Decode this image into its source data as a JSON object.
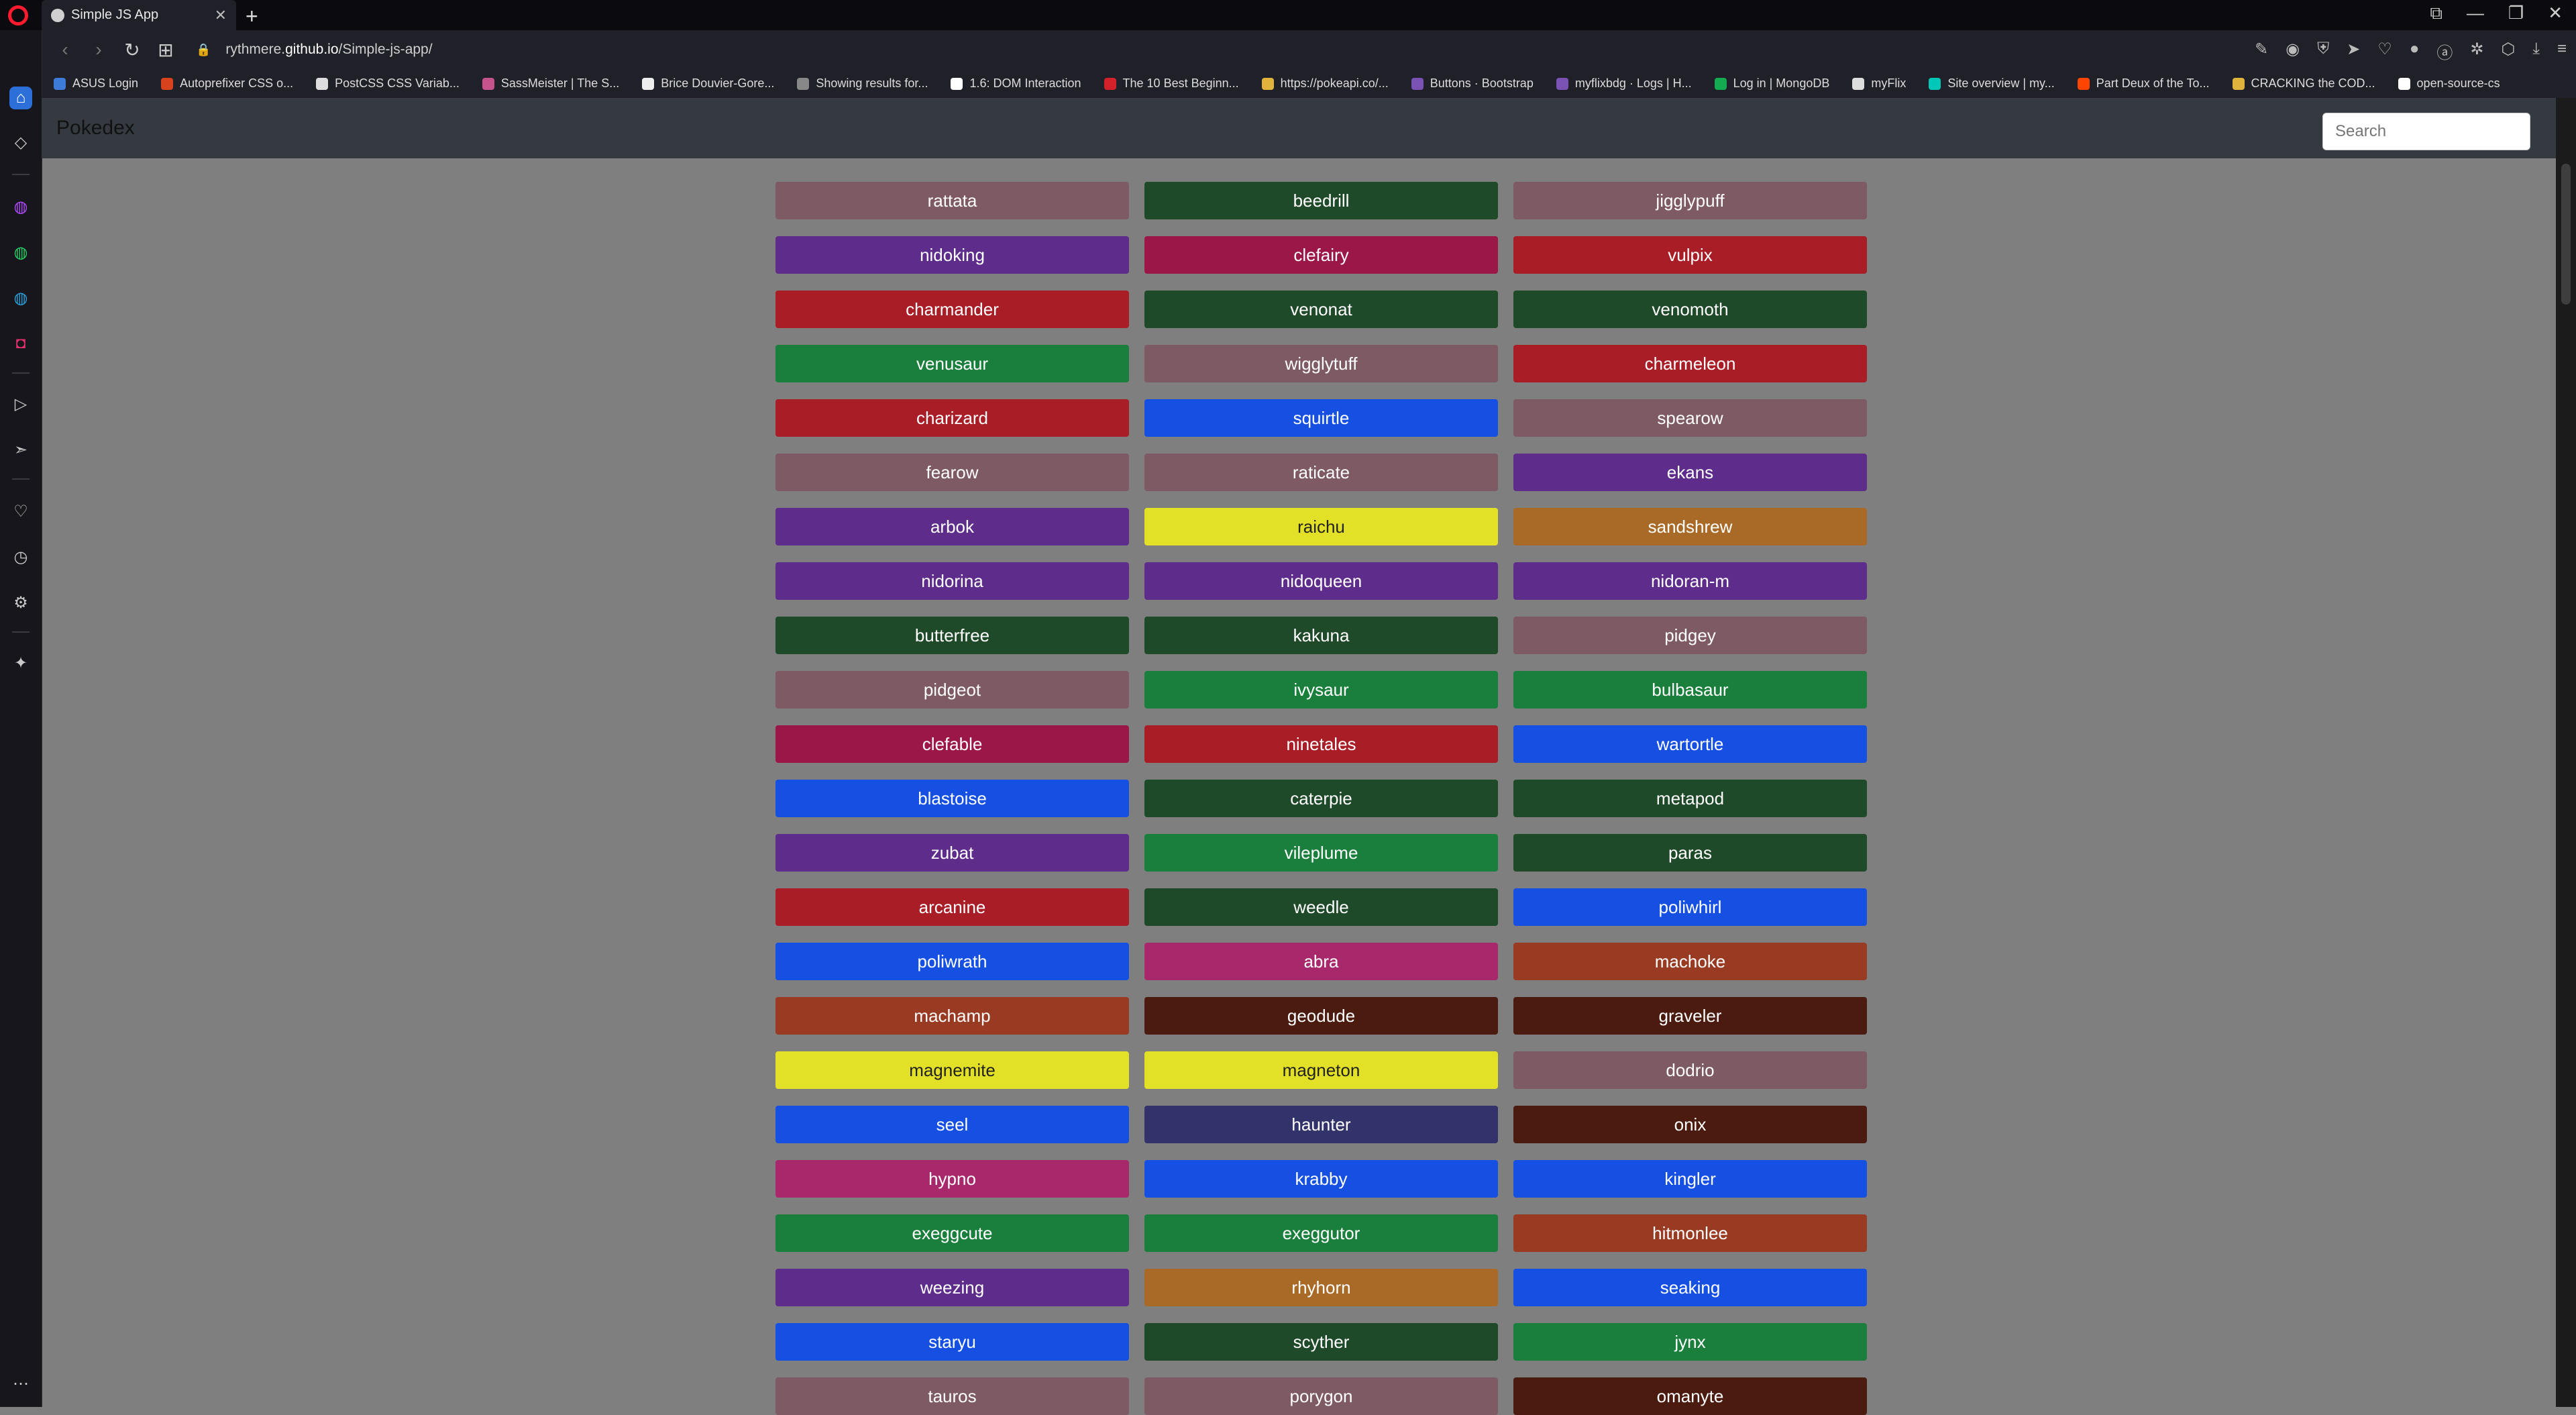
{
  "browser": {
    "tab_title": "Simple JS App",
    "url_prefix": "rythmere.",
    "url_domain": "github.io",
    "url_path": "/Simple-js-app/",
    "bookmarks": [
      {
        "label": "ASUS Login",
        "color": "#3d7bd8"
      },
      {
        "label": "Autoprefixer CSS o...",
        "color": "#d8431e"
      },
      {
        "label": "PostCSS CSS Variab...",
        "color": "#dddddd"
      },
      {
        "label": "SassMeister | The S...",
        "color": "#c6538c"
      },
      {
        "label": "Brice Douvier-Gore...",
        "color": "#eeeeee"
      },
      {
        "label": "Showing results for...",
        "color": "#888888"
      },
      {
        "label": "1.6: DOM Interaction",
        "color": "#ffffff"
      },
      {
        "label": "The 10 Best Beginn...",
        "color": "#d22128"
      },
      {
        "label": "https://pokeapi.co/...",
        "color": "#e0b43c"
      },
      {
        "label": "Buttons · Bootstrap",
        "color": "#7952b3"
      },
      {
        "label": "myflixbdg · Logs | H...",
        "color": "#7952b3"
      },
      {
        "label": "Log in | MongoDB",
        "color": "#13aa52"
      },
      {
        "label": "myFlix",
        "color": "#dddddd"
      },
      {
        "label": "Site overview | my...",
        "color": "#00c7b7"
      },
      {
        "label": "Part Deux of the To...",
        "color": "#ff4500"
      },
      {
        "label": "CRACKING the COD...",
        "color": "#e0b43c"
      },
      {
        "label": "open-source-cs",
        "color": "#ffffff"
      }
    ]
  },
  "page": {
    "brand": "Pokedex",
    "search_placeholder": "Search"
  },
  "colors": {
    "normal": "#7d5a64",
    "bug": "#1f4a29",
    "grass": "#1a7f3c",
    "fire": "#a91d26",
    "water": "#1550e3",
    "poison": "#5e2d8c",
    "fairy": "#9b1748",
    "electric": "#e3e028",
    "ground": "#a96a27",
    "fighting": "#993b22",
    "rock": "#4b1b10",
    "psychic": "#a8296b",
    "ghost": "#33336b"
  },
  "pokemon": [
    {
      "name": "rattata",
      "type": "normal"
    },
    {
      "name": "beedrill",
      "type": "bug"
    },
    {
      "name": "jigglypuff",
      "type": "normal"
    },
    {
      "name": "nidoking",
      "type": "poison"
    },
    {
      "name": "clefairy",
      "type": "fairy"
    },
    {
      "name": "vulpix",
      "type": "fire"
    },
    {
      "name": "charmander",
      "type": "fire"
    },
    {
      "name": "venonat",
      "type": "bug"
    },
    {
      "name": "venomoth",
      "type": "bug"
    },
    {
      "name": "venusaur",
      "type": "grass"
    },
    {
      "name": "wigglytuff",
      "type": "normal"
    },
    {
      "name": "charmeleon",
      "type": "fire"
    },
    {
      "name": "charizard",
      "type": "fire"
    },
    {
      "name": "squirtle",
      "type": "water"
    },
    {
      "name": "spearow",
      "type": "normal"
    },
    {
      "name": "fearow",
      "type": "normal"
    },
    {
      "name": "raticate",
      "type": "normal"
    },
    {
      "name": "ekans",
      "type": "poison"
    },
    {
      "name": "arbok",
      "type": "poison"
    },
    {
      "name": "raichu",
      "type": "electric"
    },
    {
      "name": "sandshrew",
      "type": "ground"
    },
    {
      "name": "nidorina",
      "type": "poison"
    },
    {
      "name": "nidoqueen",
      "type": "poison"
    },
    {
      "name": "nidoran-m",
      "type": "poison"
    },
    {
      "name": "butterfree",
      "type": "bug"
    },
    {
      "name": "kakuna",
      "type": "bug"
    },
    {
      "name": "pidgey",
      "type": "normal"
    },
    {
      "name": "pidgeot",
      "type": "normal"
    },
    {
      "name": "ivysaur",
      "type": "grass"
    },
    {
      "name": "bulbasaur",
      "type": "grass"
    },
    {
      "name": "clefable",
      "type": "fairy"
    },
    {
      "name": "ninetales",
      "type": "fire"
    },
    {
      "name": "wartortle",
      "type": "water"
    },
    {
      "name": "blastoise",
      "type": "water"
    },
    {
      "name": "caterpie",
      "type": "bug"
    },
    {
      "name": "metapod",
      "type": "bug"
    },
    {
      "name": "zubat",
      "type": "poison"
    },
    {
      "name": "vileplume",
      "type": "grass"
    },
    {
      "name": "paras",
      "type": "bug"
    },
    {
      "name": "arcanine",
      "type": "fire"
    },
    {
      "name": "weedle",
      "type": "bug"
    },
    {
      "name": "poliwhirl",
      "type": "water"
    },
    {
      "name": "poliwrath",
      "type": "water"
    },
    {
      "name": "abra",
      "type": "psychic"
    },
    {
      "name": "machoke",
      "type": "fighting"
    },
    {
      "name": "machamp",
      "type": "fighting"
    },
    {
      "name": "geodude",
      "type": "rock"
    },
    {
      "name": "graveler",
      "type": "rock"
    },
    {
      "name": "magnemite",
      "type": "electric"
    },
    {
      "name": "magneton",
      "type": "electric"
    },
    {
      "name": "dodrio",
      "type": "normal"
    },
    {
      "name": "seel",
      "type": "water"
    },
    {
      "name": "haunter",
      "type": "ghost"
    },
    {
      "name": "onix",
      "type": "rock"
    },
    {
      "name": "hypno",
      "type": "psychic"
    },
    {
      "name": "krabby",
      "type": "water"
    },
    {
      "name": "kingler",
      "type": "water"
    },
    {
      "name": "exeggcute",
      "type": "grass"
    },
    {
      "name": "exeggutor",
      "type": "grass"
    },
    {
      "name": "hitmonlee",
      "type": "fighting"
    },
    {
      "name": "weezing",
      "type": "poison"
    },
    {
      "name": "rhyhorn",
      "type": "ground"
    },
    {
      "name": "seaking",
      "type": "water"
    },
    {
      "name": "staryu",
      "type": "water"
    },
    {
      "name": "scyther",
      "type": "bug"
    },
    {
      "name": "jynx",
      "type": "grass"
    },
    {
      "name": "tauros",
      "type": "normal"
    },
    {
      "name": "porygon",
      "type": "normal"
    },
    {
      "name": "omanyte",
      "type": "rock"
    }
  ]
}
